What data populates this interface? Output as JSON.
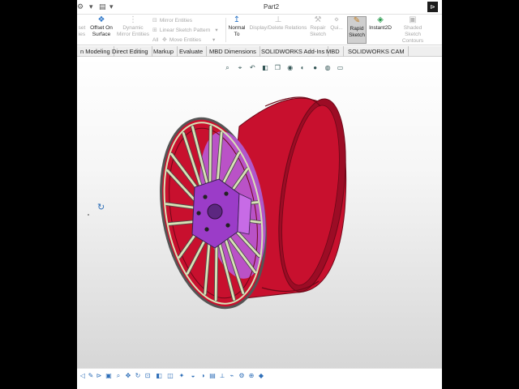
{
  "window": {
    "title": "Part2"
  },
  "quick_access": [
    {
      "name": "options-icon",
      "glyph": "⚙"
    },
    {
      "name": "dropdown-icon",
      "glyph": "▾"
    },
    {
      "name": "print-icon",
      "glyph": "▤"
    },
    {
      "name": "dropdown-icon-2",
      "glyph": "▾"
    }
  ],
  "ribbon": {
    "offset_cut": {
      "line1": "set",
      "line2": "ies"
    },
    "offset_on_surface": {
      "line1": "Offset On",
      "line2": "Surface"
    },
    "dynamic_mirror": {
      "line1": "Dynamic",
      "line2": "Mirror Entities"
    },
    "mirror_entities": "Mirror Entities",
    "linear_sketch_pattern": "Linear Sketch Pattern",
    "move_entities": "Move Entities",
    "all_label": "All",
    "normal_to": {
      "line1": "Normal",
      "line2": "To"
    },
    "display_delete_relations": "Display/Delete Relations",
    "repair_sketch": {
      "line1": "Repair",
      "line2": "Sketch"
    },
    "quick_snaps": {
      "line1": "Qui..."
    },
    "rapid_sketch": {
      "line1": "Rapid",
      "line2": "Sketch"
    },
    "instant2d": "Instant2D",
    "shaded_sketch_contours": {
      "line1": "Shaded Sketch",
      "line2": "Contours"
    }
  },
  "tabs": [
    "n Modeling",
    "Direct Editing",
    "Markup",
    "Evaluate",
    "MBD Dimensions",
    "SOLIDWORKS Add-Ins",
    "MBD",
    "SOLIDWORKS CAM"
  ],
  "heads_up_toolbar": [
    "zoom-to-fit",
    "zoom-to-area",
    "previous-view",
    "section-view",
    "view-orientation",
    "display-style",
    "hide-show",
    "edit-appearance",
    "apply-scene",
    "view-settings"
  ],
  "colors": {
    "rim": "#c8102e",
    "rim_dark": "#9c0c25",
    "rim_edge": "#6e0818",
    "spokes": "#d8e2b6",
    "spoke_edge": "#4a4a4a",
    "hub": "#9b3cc8",
    "hub_light": "#c76be6",
    "inner_barrel": "#b85ad8"
  },
  "bottom_toolbar": [
    "view-icon",
    "tools-icon",
    "select-icon",
    "filter-icon",
    "zoom-icon",
    "pan-icon",
    "rotate-icon",
    "fit-icon",
    "section-icon",
    "camera-icon",
    "light-icon",
    "scene-icon",
    "graphics-icon",
    "display-icon",
    "measure-icon",
    "link-icon",
    "settings-icon",
    "mate-icon",
    "help-icon"
  ]
}
